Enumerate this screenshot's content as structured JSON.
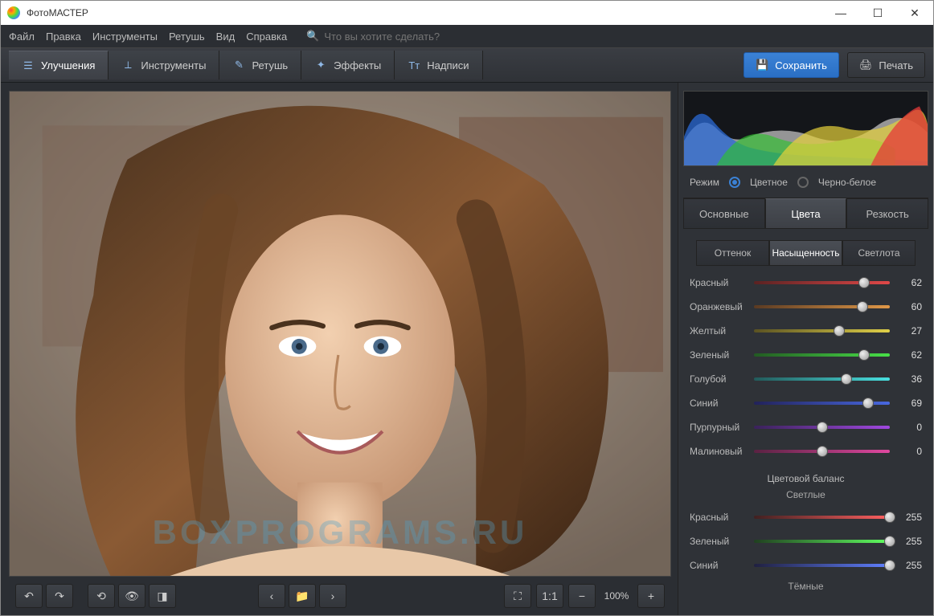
{
  "window": {
    "title": "ФотоМАСТЕР"
  },
  "menu": {
    "items": [
      "Файл",
      "Правка",
      "Инструменты",
      "Ретушь",
      "Вид",
      "Справка"
    ],
    "search_placeholder": "Что вы хотите сделать?"
  },
  "toolbar": {
    "tabs": [
      {
        "label": "Улучшения",
        "icon": "sliders-icon",
        "active": true
      },
      {
        "label": "Инструменты",
        "icon": "crop-icon",
        "active": false
      },
      {
        "label": "Ретушь",
        "icon": "brush-icon",
        "active": false
      },
      {
        "label": "Эффекты",
        "icon": "wand-icon",
        "active": false
      },
      {
        "label": "Надписи",
        "icon": "text-icon",
        "active": false
      }
    ],
    "save": "Сохранить",
    "print": "Печать"
  },
  "bottom": {
    "zoom_label": "100%",
    "one_to_one": "1:1"
  },
  "panel": {
    "mode_label": "Режим",
    "mode_color": "Цветное",
    "mode_bw": "Черно-белое",
    "main_tabs": [
      "Основные",
      "Цвета",
      "Резкость"
    ],
    "main_active": 1,
    "sub_tabs": [
      "Оттенок",
      "Насыщенность",
      "Светлота"
    ],
    "sub_active": 1,
    "sliders": [
      {
        "label": "Красный",
        "value": 62,
        "gradient": [
          "#5a2222",
          "#e04848"
        ],
        "pct": 81
      },
      {
        "label": "Оранжевый",
        "value": 60,
        "gradient": [
          "#5a3a22",
          "#e09848"
        ],
        "pct": 80
      },
      {
        "label": "Желтый",
        "value": 27,
        "gradient": [
          "#5a5222",
          "#e0d048"
        ],
        "pct": 63
      },
      {
        "label": "Зеленый",
        "value": 62,
        "gradient": [
          "#225a22",
          "#48e048"
        ],
        "pct": 81
      },
      {
        "label": "Голубой",
        "value": 36,
        "gradient": [
          "#225a5a",
          "#48e0e0"
        ],
        "pct": 68
      },
      {
        "label": "Синий",
        "value": 69,
        "gradient": [
          "#22225a",
          "#4868e0"
        ],
        "pct": 84
      },
      {
        "label": "Пурпурный",
        "value": 0,
        "gradient": [
          "#3a225a",
          "#a048e0"
        ],
        "pct": 50
      },
      {
        "label": "Малиновый",
        "value": 0,
        "gradient": [
          "#5a2242",
          "#e048a0"
        ],
        "pct": 50
      }
    ],
    "balance_title": "Цветовой баланс",
    "balance_light": "Светлые",
    "balance_sliders": [
      {
        "label": "Красный",
        "value": 255,
        "gradient": [
          "#402020",
          "#ff6060"
        ],
        "pct": 100
      },
      {
        "label": "Зеленый",
        "value": 255,
        "gradient": [
          "#204020",
          "#60ff60"
        ],
        "pct": 100
      },
      {
        "label": "Синий",
        "value": 255,
        "gradient": [
          "#202040",
          "#6080ff"
        ],
        "pct": 100
      }
    ],
    "balance_dark": "Тёмные"
  },
  "watermark": "BOXPROGRAMS.RU"
}
